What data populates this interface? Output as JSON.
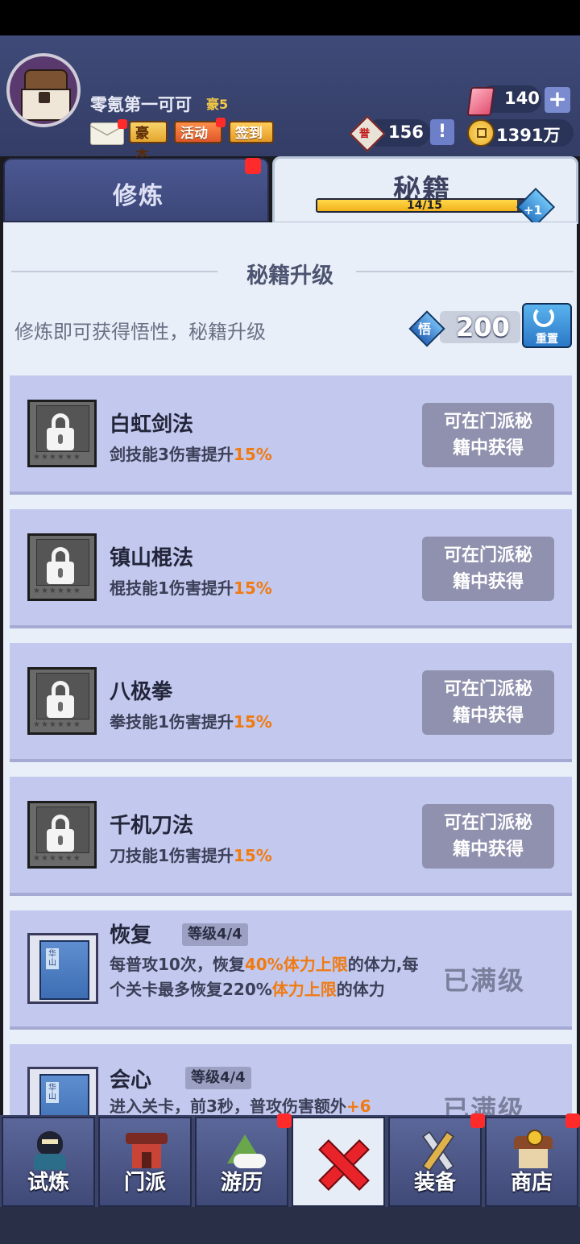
{
  "header": {
    "username": "零氪第一可可",
    "vip": "豪5",
    "tags": {
      "haojie": "豪杰",
      "activity": "活动",
      "signin": "签到"
    },
    "gems": "140",
    "honor": "156",
    "honor_char": "誉",
    "coins": "1391万",
    "plus": "+",
    "excl": "!"
  },
  "tabs": {
    "cultivate": "修炼",
    "secret": "秘籍",
    "progress_text": "14/15",
    "progress_value": 0.933,
    "plus_badge": "+1"
  },
  "panel": {
    "section_title": "秘籍升级",
    "hint": "修炼即可获得悟性，秘籍升级",
    "wu_char": "悟",
    "points": "200",
    "reset": "重置"
  },
  "cards": [
    {
      "title": "白虹剑法",
      "desc_pre": "剑技能3伤害提升",
      "desc_hl": "15%",
      "btn1": "可在门派秘",
      "btn2": "籍中获得"
    },
    {
      "title": "镇山棍法",
      "desc_pre": "棍技能1伤害提升",
      "desc_hl": "15%",
      "btn1": "可在门派秘",
      "btn2": "籍中获得"
    },
    {
      "title": "八极拳",
      "desc_pre": "拳技能1伤害提升",
      "desc_hl": "15%",
      "btn1": "可在门派秘",
      "btn2": "籍中获得"
    },
    {
      "title": "千机刀法",
      "desc_pre": "刀技能1伤害提升",
      "desc_hl": "15%",
      "btn1": "可在门派秘",
      "btn2": "籍中获得"
    }
  ],
  "unlocked": [
    {
      "title": "恢复",
      "level": "等级4/4",
      "book_label": "华山",
      "d1": "每普攻10次，恢复",
      "d2": "40%体力上限",
      "d3": "的体力,每个关卡最多恢复220%",
      "d4": "体力上限",
      "d5": "的体力",
      "status": "已满级"
    },
    {
      "title": "会心",
      "level": "等级4/4",
      "book_label": "华山",
      "d1": "进入关卡，前3秒，普攻伤害额外",
      "d2": "+6",
      "status": "已满级"
    }
  ],
  "nav": [
    {
      "label": "试炼"
    },
    {
      "label": "门派"
    },
    {
      "label": "游历"
    },
    {
      "label": ""
    },
    {
      "label": "装备"
    },
    {
      "label": "商店"
    }
  ],
  "colors": {
    "highlight": "#f07a12",
    "badge_red": "#ff2a2a"
  }
}
